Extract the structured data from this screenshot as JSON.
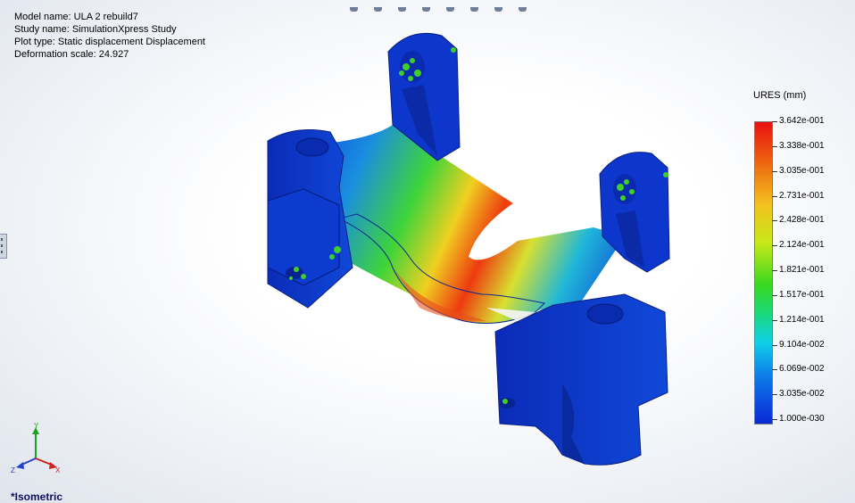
{
  "study_info": {
    "model_name": "Model name: ULA 2 rebuild7",
    "study_name": "Study name: SimulationXpress Study",
    "plot_type": "Plot type: Static displacement Displacement",
    "deformation_scale": "Deformation scale: 24.927"
  },
  "legend": {
    "title": "URES (mm)",
    "values": [
      "3.642e-001",
      "3.338e-001",
      "3.035e-001",
      "2.731e-001",
      "2.428e-001",
      "2.124e-001",
      "1.821e-001",
      "1.517e-001",
      "1.214e-001",
      "9.104e-002",
      "6.069e-002",
      "3.035e-002",
      "1.000e-030"
    ],
    "colors": {
      "max": "#e81010",
      "mid": "#38d820",
      "min": "#0a28d6"
    }
  },
  "triad": {
    "x_label": "X",
    "y_label": "Y",
    "z_label": "Z"
  },
  "view": {
    "label": "*Isometric"
  },
  "icons": [
    "view-toolbar-icons",
    "panel-expand-handle-icon",
    "coordinate-triad-icon",
    "fixture-marker-icon"
  ]
}
